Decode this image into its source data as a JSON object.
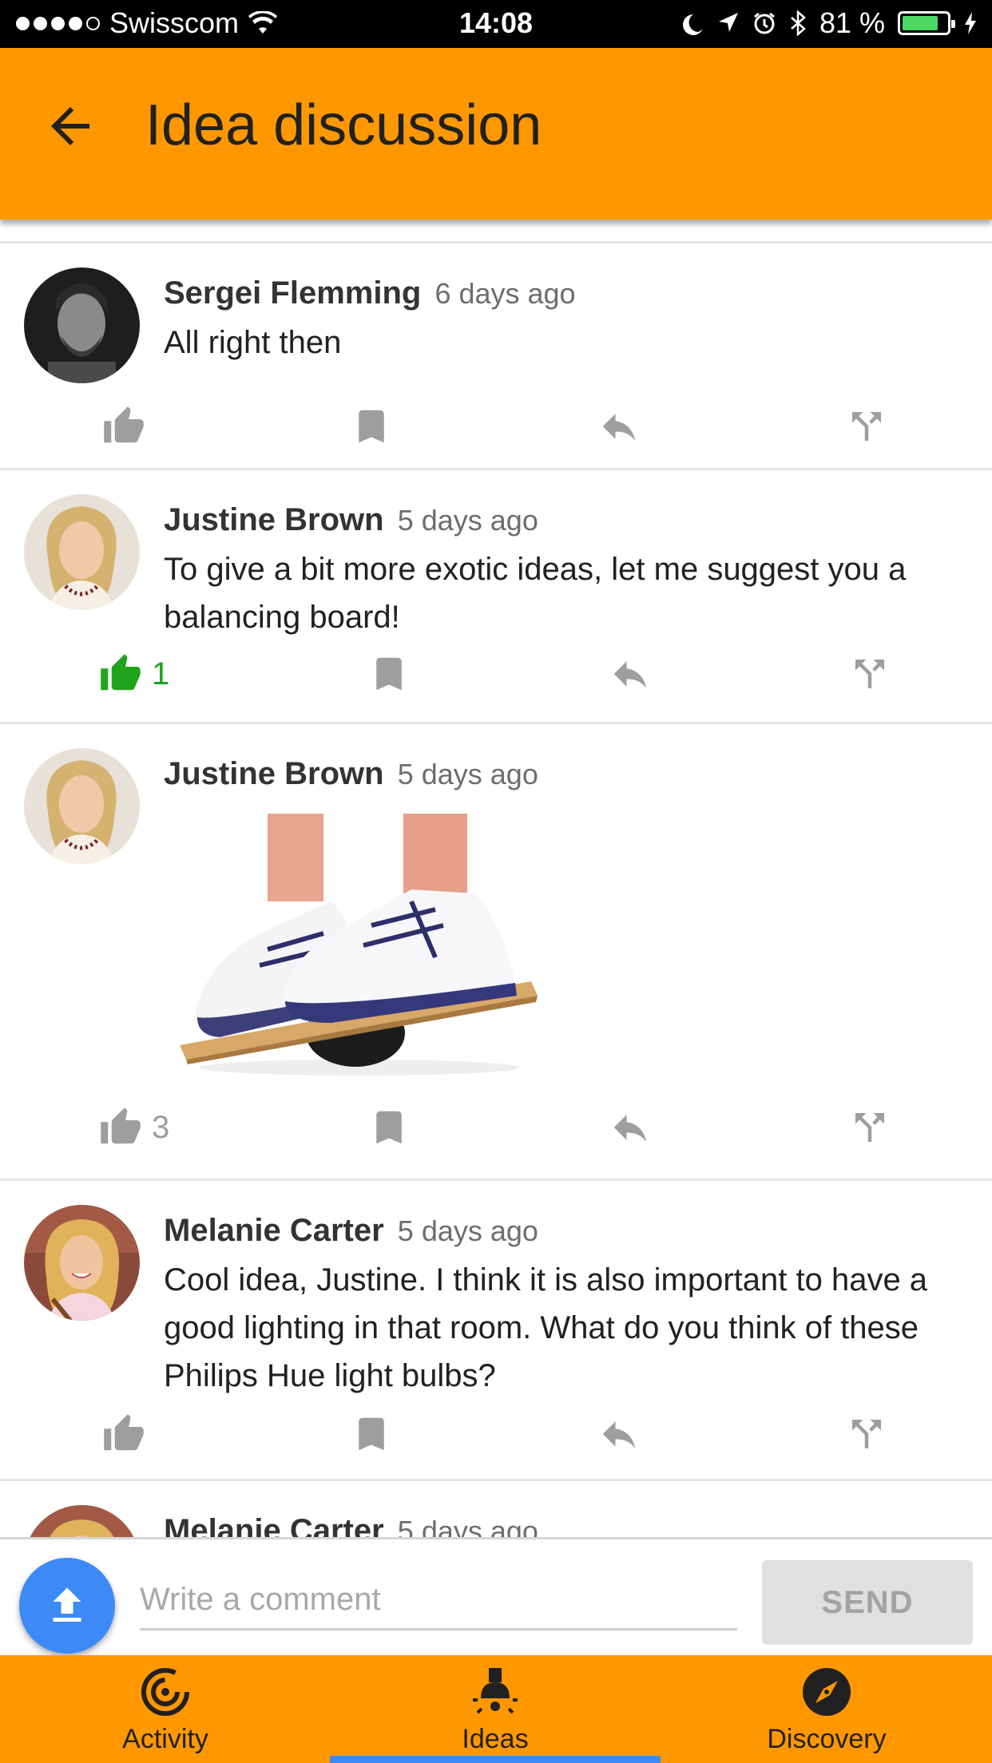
{
  "status_bar": {
    "carrier": "Swisscom",
    "time": "14:08",
    "battery": "81 %",
    "battery_level": 0.81
  },
  "header": {
    "title": "Idea discussion",
    "back_icon": "arrow-back-icon"
  },
  "comments": [
    {
      "author": "Sergei Flemming",
      "time": "6 days ago",
      "text": "All right then",
      "likes": "",
      "liked": false
    },
    {
      "author": "Justine Brown",
      "time": "5 days ago",
      "text": "To give a bit more exotic ideas, let me suggest you a balancing board!",
      "likes": "1",
      "liked": true
    },
    {
      "author": "Justine Brown",
      "time": "5 days ago",
      "text": "",
      "image": "balance-board-photo",
      "likes": "3",
      "liked": false
    },
    {
      "author": "Melanie Carter",
      "time": "5 days ago",
      "text": "Cool idea, Justine. I think it is also important to have a good lighting in that room. What do you think of these Philips Hue light bulbs?",
      "likes": "",
      "liked": false
    },
    {
      "author": "Melanie Carter",
      "time": "5 days ago"
    }
  ],
  "actions": {
    "like_icon": "thumbs-up-icon",
    "bookmark_icon": "bookmark-icon",
    "reply_icon": "reply-icon",
    "fork_icon": "fork-icon"
  },
  "composer": {
    "placeholder": "Write a comment",
    "value": "",
    "send_label": "SEND",
    "upload_icon": "upload-icon"
  },
  "bottom_nav": {
    "items": [
      {
        "label": "Activity",
        "icon": "activity-icon"
      },
      {
        "label": "Ideas",
        "icon": "lightbulb-icon"
      },
      {
        "label": "Discovery",
        "icon": "compass-icon"
      }
    ],
    "active": "Ideas"
  },
  "colors": {
    "accent": "#ff9800",
    "primary_blue": "#3d8af7",
    "liked_green": "#21a31c"
  }
}
